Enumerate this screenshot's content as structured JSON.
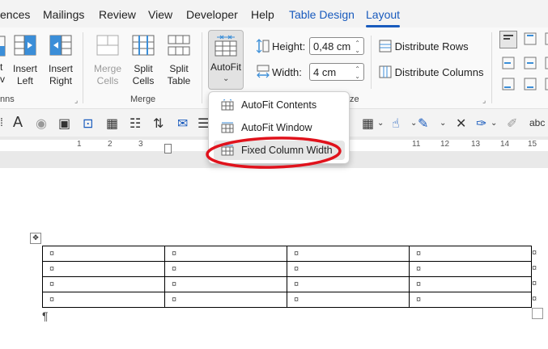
{
  "tabs": [
    {
      "label": "ences"
    },
    {
      "label": "Mailings"
    },
    {
      "label": "Review"
    },
    {
      "label": "View"
    },
    {
      "label": "Developer"
    },
    {
      "label": "Help"
    },
    {
      "label": "Table Design"
    },
    {
      "label": "Layout"
    }
  ],
  "ribbon": {
    "rows_cols": {
      "left_cut_label_1": "t",
      "left_cut_label_2": "v",
      "insert_left": [
        "Insert",
        "Left"
      ],
      "insert_right": [
        "Insert",
        "Right"
      ],
      "group_label": "nns"
    },
    "merge": {
      "merge_cells": [
        "Merge",
        "Cells"
      ],
      "split_cells": [
        "Split",
        "Cells"
      ],
      "split_table": [
        "Split",
        "Table"
      ],
      "group_label": "Merge"
    },
    "cell_size": {
      "autofit": "AutoFit",
      "height_label": "Height:",
      "height_value": "0,48 cm",
      "width_label": "Width:",
      "width_value": "4 cm",
      "distribute_rows": "Distribute Rows",
      "distribute_columns": "Distribute Columns",
      "group_label": "ze"
    }
  },
  "autofit_menu": {
    "items": [
      {
        "label": "AutoFit Contents"
      },
      {
        "label": "AutoFit Window"
      },
      {
        "label": "Fixed Column Width"
      }
    ]
  },
  "ruler": {
    "numbers_left": [
      "1",
      "2",
      "3"
    ],
    "numbers_right": [
      "11",
      "12",
      "13",
      "14",
      "15"
    ]
  },
  "document": {
    "cell_marker": "¤",
    "paragraph_mark": "¶",
    "rows": 4,
    "cols": 4
  },
  "colors": {
    "accent": "#185abd",
    "highlight_ring": "#e0121c"
  }
}
